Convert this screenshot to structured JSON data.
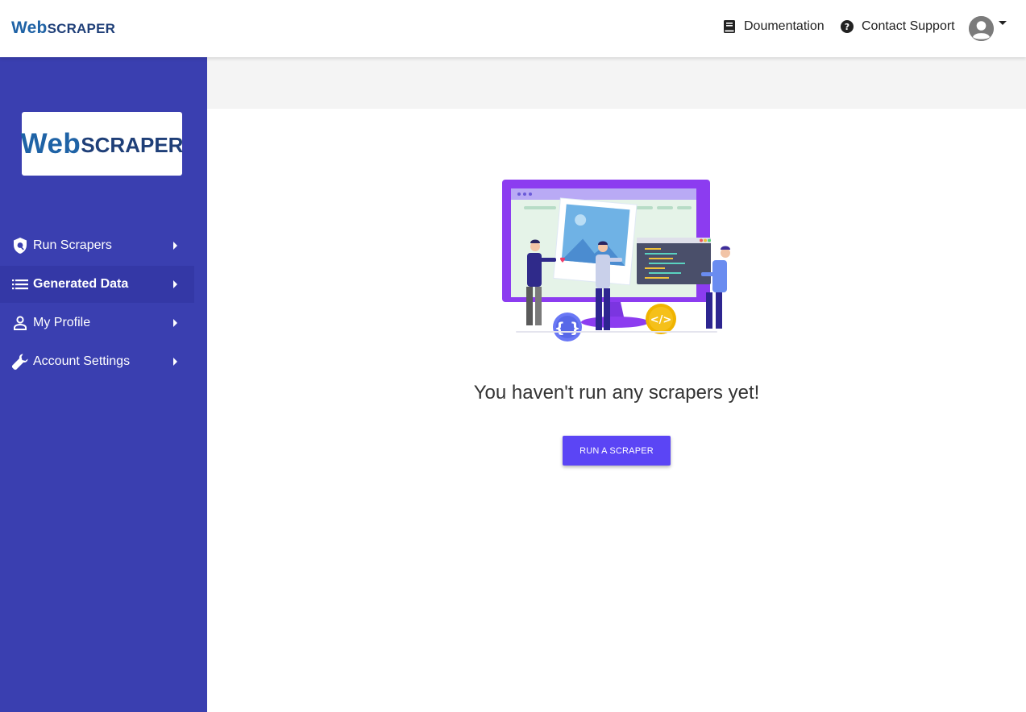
{
  "header": {
    "logo_web": "Web",
    "logo_scraper": "SCRAPER",
    "documentation_label": "Doumentation",
    "contact_support_label": "Contact Support",
    "user_menu_icon": "account-circle-icon"
  },
  "sidebar": {
    "logo_web": "Web",
    "logo_scraper": "SCRAPER",
    "background_color": "#3a3fb0",
    "items": [
      {
        "label": "Run Scrapers",
        "icon": "shield-icon",
        "active": false
      },
      {
        "label": "Generated Data",
        "icon": "list-icon",
        "active": true
      },
      {
        "label": "My Profile",
        "icon": "person-icon",
        "active": false
      },
      {
        "label": "Account Settings",
        "icon": "wrench-icon",
        "active": false
      }
    ]
  },
  "main": {
    "empty_message": "You haven't run any scrapers yet!",
    "run_button_label": "RUN A SCRAPER",
    "button_color": "#5b45f5",
    "illustration_icon": "web-development-illustration"
  }
}
